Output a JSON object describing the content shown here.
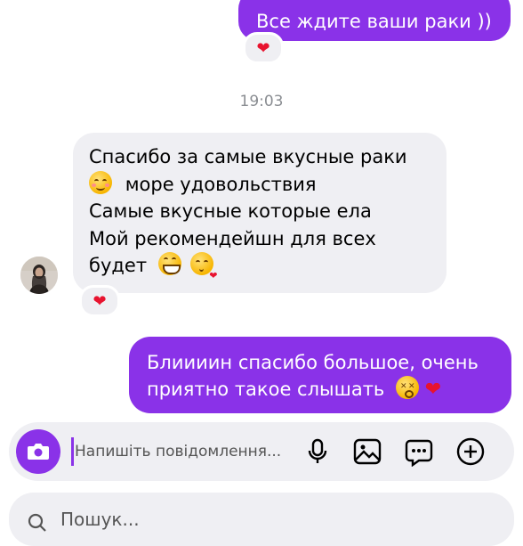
{
  "colors": {
    "accent": "#8a32e8",
    "incoming_bubble": "#efeff3",
    "heart": "#e8132f",
    "timestamp": "#8a8d92"
  },
  "messages": [
    {
      "direction": "outgoing",
      "lines": [
        "Все ждите ваши раки ))"
      ],
      "reaction": "❤"
    },
    {
      "direction": "incoming",
      "lines": [
        "Спасибо за самые вкусные раки",
        "море удовольствия",
        "Самые вкусные которые ела",
        "Мой рекомендейшн для всех",
        "будет"
      ],
      "emojis": [
        "relieved-face",
        "grinning-face",
        "face-blowing-kiss"
      ],
      "reaction": "❤"
    },
    {
      "direction": "outgoing",
      "lines": [
        "Блиииин спасибо большое, очень",
        "приятно такое слышать"
      ],
      "emojis": [
        "face-exhaling",
        "red-heart"
      ]
    }
  ],
  "timestamp": "19:03",
  "composer": {
    "placeholder": "Напишіть повідомлення...",
    "icons": [
      "camera-icon",
      "microphone-icon",
      "gallery-icon",
      "sticker-icon",
      "add-icon"
    ]
  },
  "search": {
    "icon": "search-icon",
    "placeholder": "Пошук...",
    "partially_visible": true
  }
}
